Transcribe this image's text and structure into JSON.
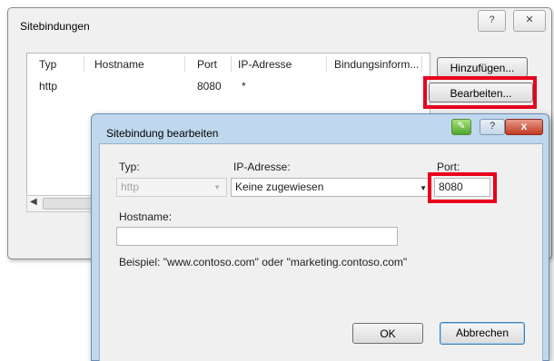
{
  "back_dialog": {
    "title": "Sitebindungen",
    "help_glyph": "?",
    "close_glyph": "✕",
    "columns": [
      "Typ",
      "Hostname",
      "Port",
      "IP-Adresse",
      "Bindungsinform..."
    ],
    "rows": [
      {
        "typ": "http",
        "hostname": "",
        "port": "8080",
        "ip": "*",
        "info": ""
      }
    ],
    "scroll_left_glyph": "◀",
    "add_button": "Hinzufügen...",
    "edit_button": "Bearbeiten..."
  },
  "front_dialog": {
    "title": "Sitebindung bearbeiten",
    "help_glyph": "?",
    "close_glyph": "x",
    "typ_label": "Typ:",
    "typ_value": "http",
    "ip_label": "IP-Adresse:",
    "ip_value": "Keine zugewiesen",
    "port_label": "Port:",
    "port_value": "8080",
    "hostname_label": "Hostname:",
    "hostname_value": "",
    "example_text": "Beispiel: \"www.contoso.com\" oder \"marketing.contoso.com\"",
    "ok_button": "OK",
    "cancel_button": "Abbrechen",
    "dropdown_glyph": "▼"
  },
  "colors": {
    "highlight": "#e8001c",
    "front_frame": "#bfd8ee",
    "dialog_face": "#f0f0f0"
  },
  "icons": {
    "help": "help-icon",
    "close": "close-icon",
    "dialog": "dialog-app-icon",
    "dropdown": "chevron-down-icon"
  }
}
